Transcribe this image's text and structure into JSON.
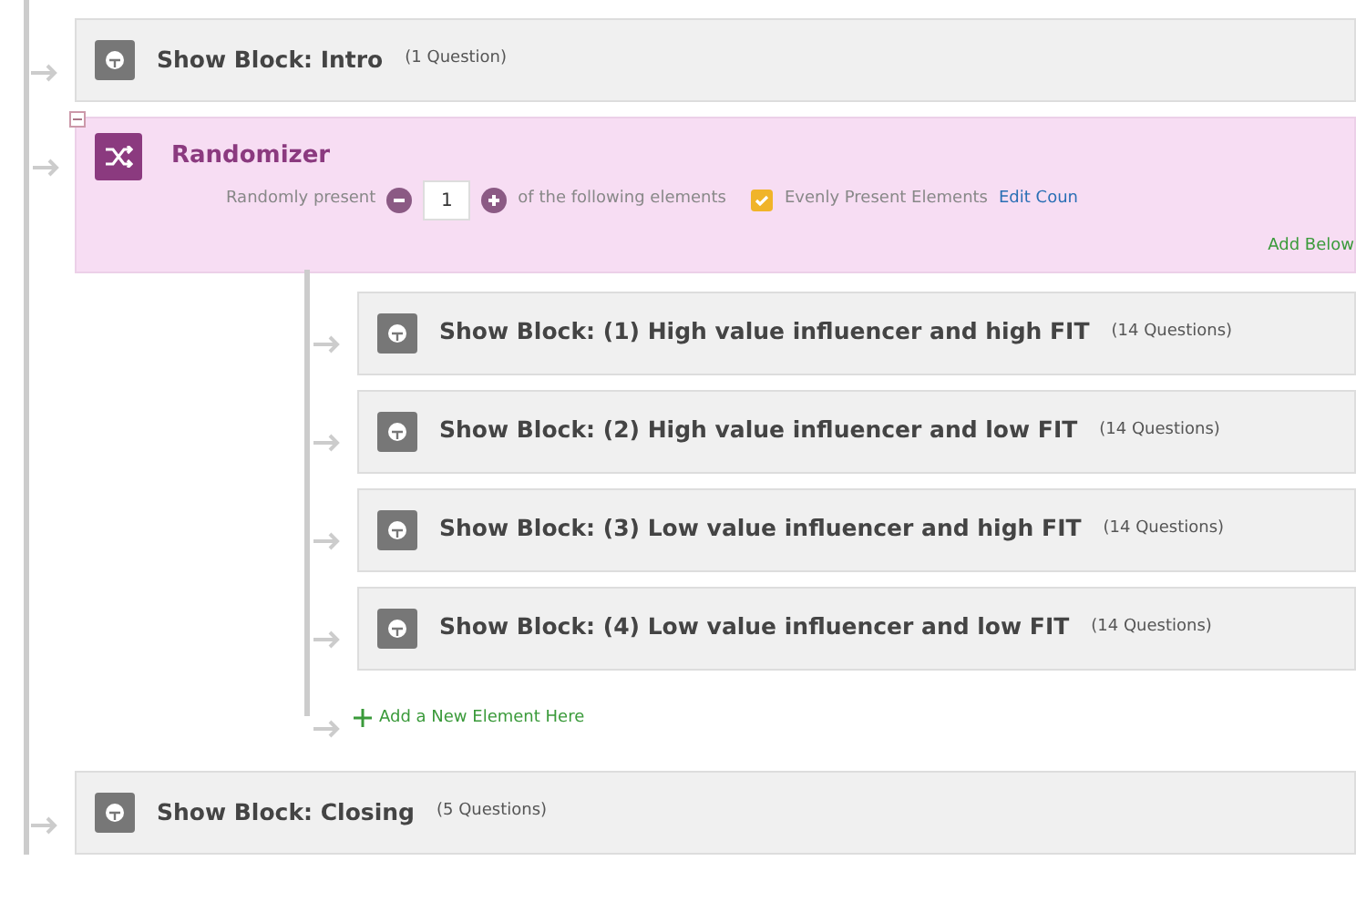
{
  "blocks_before": [
    {
      "title": "Show Block: Intro",
      "count": "(1 Question)"
    }
  ],
  "randomizer": {
    "title": "Randomizer",
    "present_label": "Randomly present",
    "present_value": "1",
    "present_suffix": "of the following elements",
    "evenly": {
      "label": "Evenly Present Elements",
      "checked": true
    },
    "edit_link": "Edit Coun",
    "add_below": "Add Below",
    "blocks": [
      {
        "title": "Show Block: (1) High value influencer and high FIT",
        "count": "(14 Questions)"
      },
      {
        "title": "Show Block: (2) High value influencer and low FIT",
        "count": "(14 Questions)"
      },
      {
        "title": "Show Block: (3) Low value influencer and high FIT",
        "count": "(14 Questions)"
      },
      {
        "title": "Show Block: (4) Low value influencer and low FIT",
        "count": "(14 Questions)"
      }
    ],
    "add_element": "Add a New Element Here"
  },
  "blocks_after": [
    {
      "title": "Show Block: Closing",
      "count": "(5 Questions)"
    }
  ]
}
